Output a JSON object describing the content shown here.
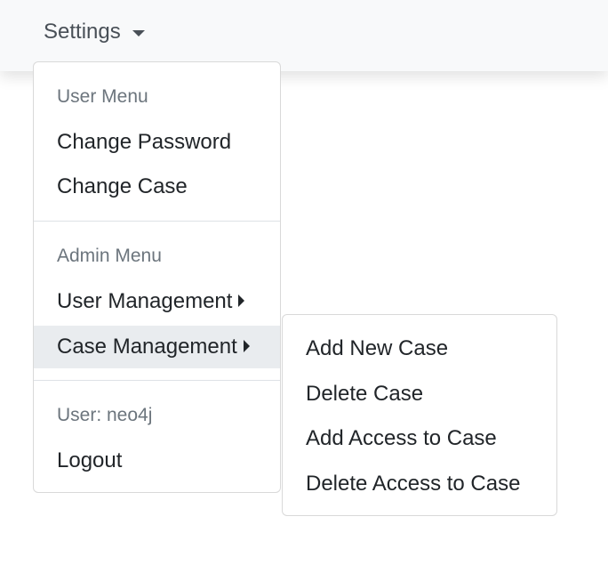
{
  "navbar": {
    "settings_label": "Settings"
  },
  "menu": {
    "user_header": "User Menu",
    "change_password": "Change Password",
    "change_case": "Change Case",
    "admin_header": "Admin Menu",
    "user_management": "User Management",
    "case_management": "Case Management",
    "user_info": "User: neo4j",
    "logout": "Logout"
  },
  "case_submenu": {
    "items": [
      {
        "label": "Add New Case"
      },
      {
        "label": "Delete Case"
      },
      {
        "label": "Add Access to Case"
      },
      {
        "label": "Delete Access to Case"
      }
    ]
  },
  "colors": {
    "navbar_bg": "#f8f9fa",
    "active_item_bg": "#e9ecef",
    "header_text": "#6c757d",
    "body_text": "#212529"
  }
}
